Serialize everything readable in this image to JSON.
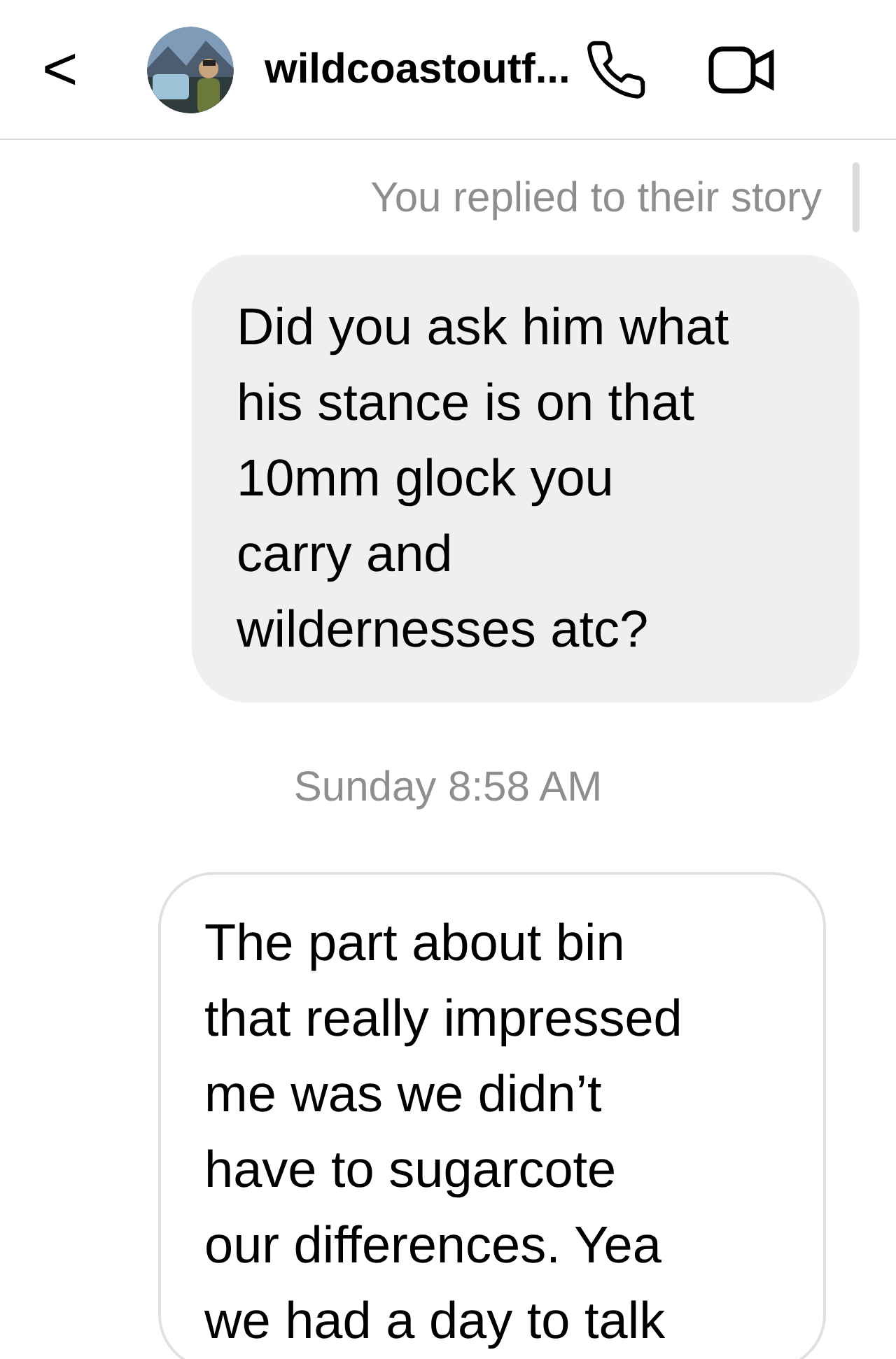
{
  "header": {
    "back": "<",
    "title": "wildcoastoutf..."
  },
  "story_reply_note": "You replied to their story",
  "messages": [
    {
      "kind": "sent",
      "lines": [
        "Did you ask him what",
        "his stance is on that",
        "10mm glock you",
        "carry and",
        "wildernesses atc?"
      ]
    },
    {
      "kind": "timestamp",
      "text": "Sunday 8:58 AM"
    },
    {
      "kind": "received",
      "lines": [
        "The part about bin",
        "that really impressed",
        "me was we didn’t",
        "have to sugarcote",
        "our differences. Yea",
        "we had a day to talk"
      ]
    }
  ]
}
